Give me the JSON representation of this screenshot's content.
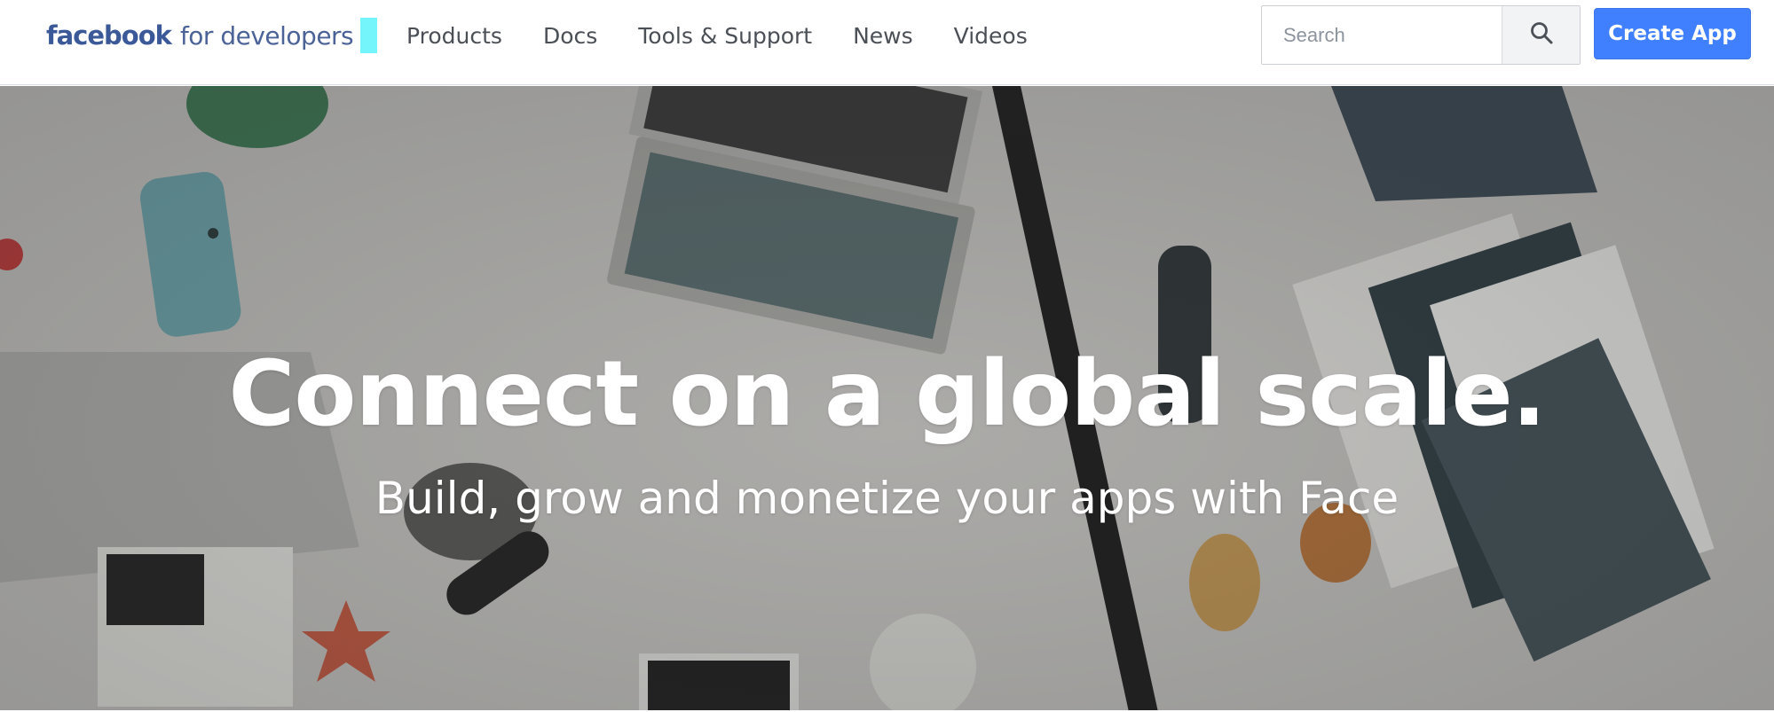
{
  "header": {
    "logo": {
      "brand": "facebook",
      "suffix": "for developers",
      "cursor_color": "#73f5fb",
      "brand_color": "#3b5998"
    },
    "nav": [
      {
        "label": "Products"
      },
      {
        "label": "Docs"
      },
      {
        "label": "Tools & Support"
      },
      {
        "label": "News"
      },
      {
        "label": "Videos"
      }
    ],
    "search": {
      "placeholder": "Search",
      "value": "",
      "icon": "search-icon"
    },
    "create_app_label": "Create App",
    "accent_color": "#4080ff"
  },
  "hero": {
    "title": "Connect on a global scale.",
    "subtitle": "Build, grow and monetize your apps with Face",
    "background": "overhead photo of a desk with laptops, phone, papers and office supplies"
  }
}
